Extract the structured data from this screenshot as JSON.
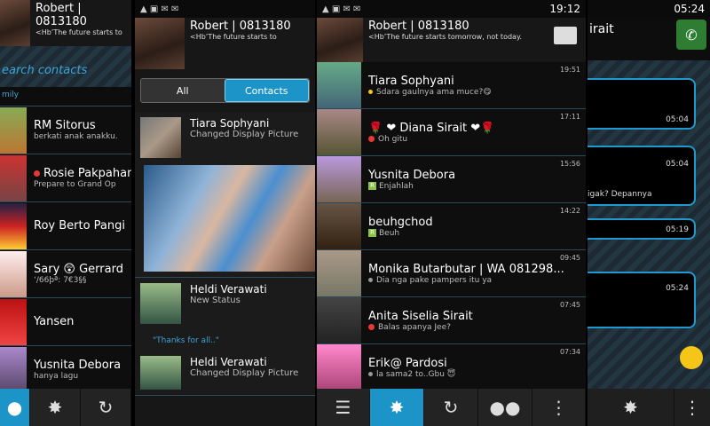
{
  "panel1": {
    "profile": {
      "name": "Robert | 0813180",
      "status": "<Hb’The future starts to"
    },
    "search_placeholder": "earch contacts",
    "section_label": "mily",
    "contacts": [
      {
        "name": "RM Sitorus",
        "status": "berkati anak anakku."
      },
      {
        "name": "Rosie Pakpahan",
        "status": "Prepare to Grand Op"
      },
      {
        "name": "Roy Berto Pangi",
        "status": ""
      },
      {
        "name": "Sary 😲 Gerrard",
        "status": "‘/66þª: 7€3§§"
      },
      {
        "name": "Yansen",
        "status": ""
      },
      {
        "name": "Yusnita Debora",
        "status": "hanya lagu"
      }
    ]
  },
  "panel2": {
    "profile": {
      "name": "Robert | 0813180",
      "status": "<Hb’The future starts to"
    },
    "segment": {
      "all": "All",
      "contacts": "Contacts"
    },
    "feed": [
      {
        "name": "Tiara Sophyani",
        "sub": "Changed Display Picture"
      },
      {
        "name": "Heldi Verawati",
        "sub": "New Status"
      },
      {
        "name": "Heldi Verawati",
        "sub": "Changed Display Picture"
      }
    ],
    "quote": "\"Thanks for all..\""
  },
  "panel3": {
    "time": "19:12",
    "profile": {
      "name": "Robert | 0813180",
      "status": "<Hb’The future starts tomorrow, not today."
    },
    "chats": [
      {
        "name": "Tiara Sophyani",
        "msg": "Sdara gaulnya ama muce?😋",
        "time": "19:51",
        "marker": "yellow"
      },
      {
        "name": "🌹 ❤ Diana Sirait ❤🌹",
        "msg": "Oh gitu",
        "time": "17:11",
        "marker": "red"
      },
      {
        "name": "Yusnita Debora",
        "msg": "Enjahlah",
        "time": "15:56",
        "marker": "R"
      },
      {
        "name": "beuhgchod",
        "msg": "Beuh",
        "time": "14:22",
        "marker": "R"
      },
      {
        "name": "Monika Butarbutar   | WA 081298...",
        "msg": "Dia nga pake pampers itu ya",
        "time": "09:45",
        "marker": "grey"
      },
      {
        "name": "Anita Siselia Sirait",
        "msg": "Balas apanya Jee?",
        "time": "07:45",
        "marker": "red"
      },
      {
        "name": "Erik@ Pardosi",
        "msg": "la sama2 to..Gbu 😇",
        "time": "07:34",
        "marker": "grey"
      }
    ]
  },
  "panel4": {
    "time": "05:24",
    "title": "irait",
    "bubbles": [
      {
        "time": "05:04",
        "text": ""
      },
      {
        "time": "05:04",
        "text": "igak? Depannya"
      },
      {
        "time": "05:19",
        "text": ""
      },
      {
        "time": "05:24",
        "text": ""
      }
    ]
  },
  "colors": {
    "accent": "#1c94c8",
    "red": "#e53935"
  }
}
